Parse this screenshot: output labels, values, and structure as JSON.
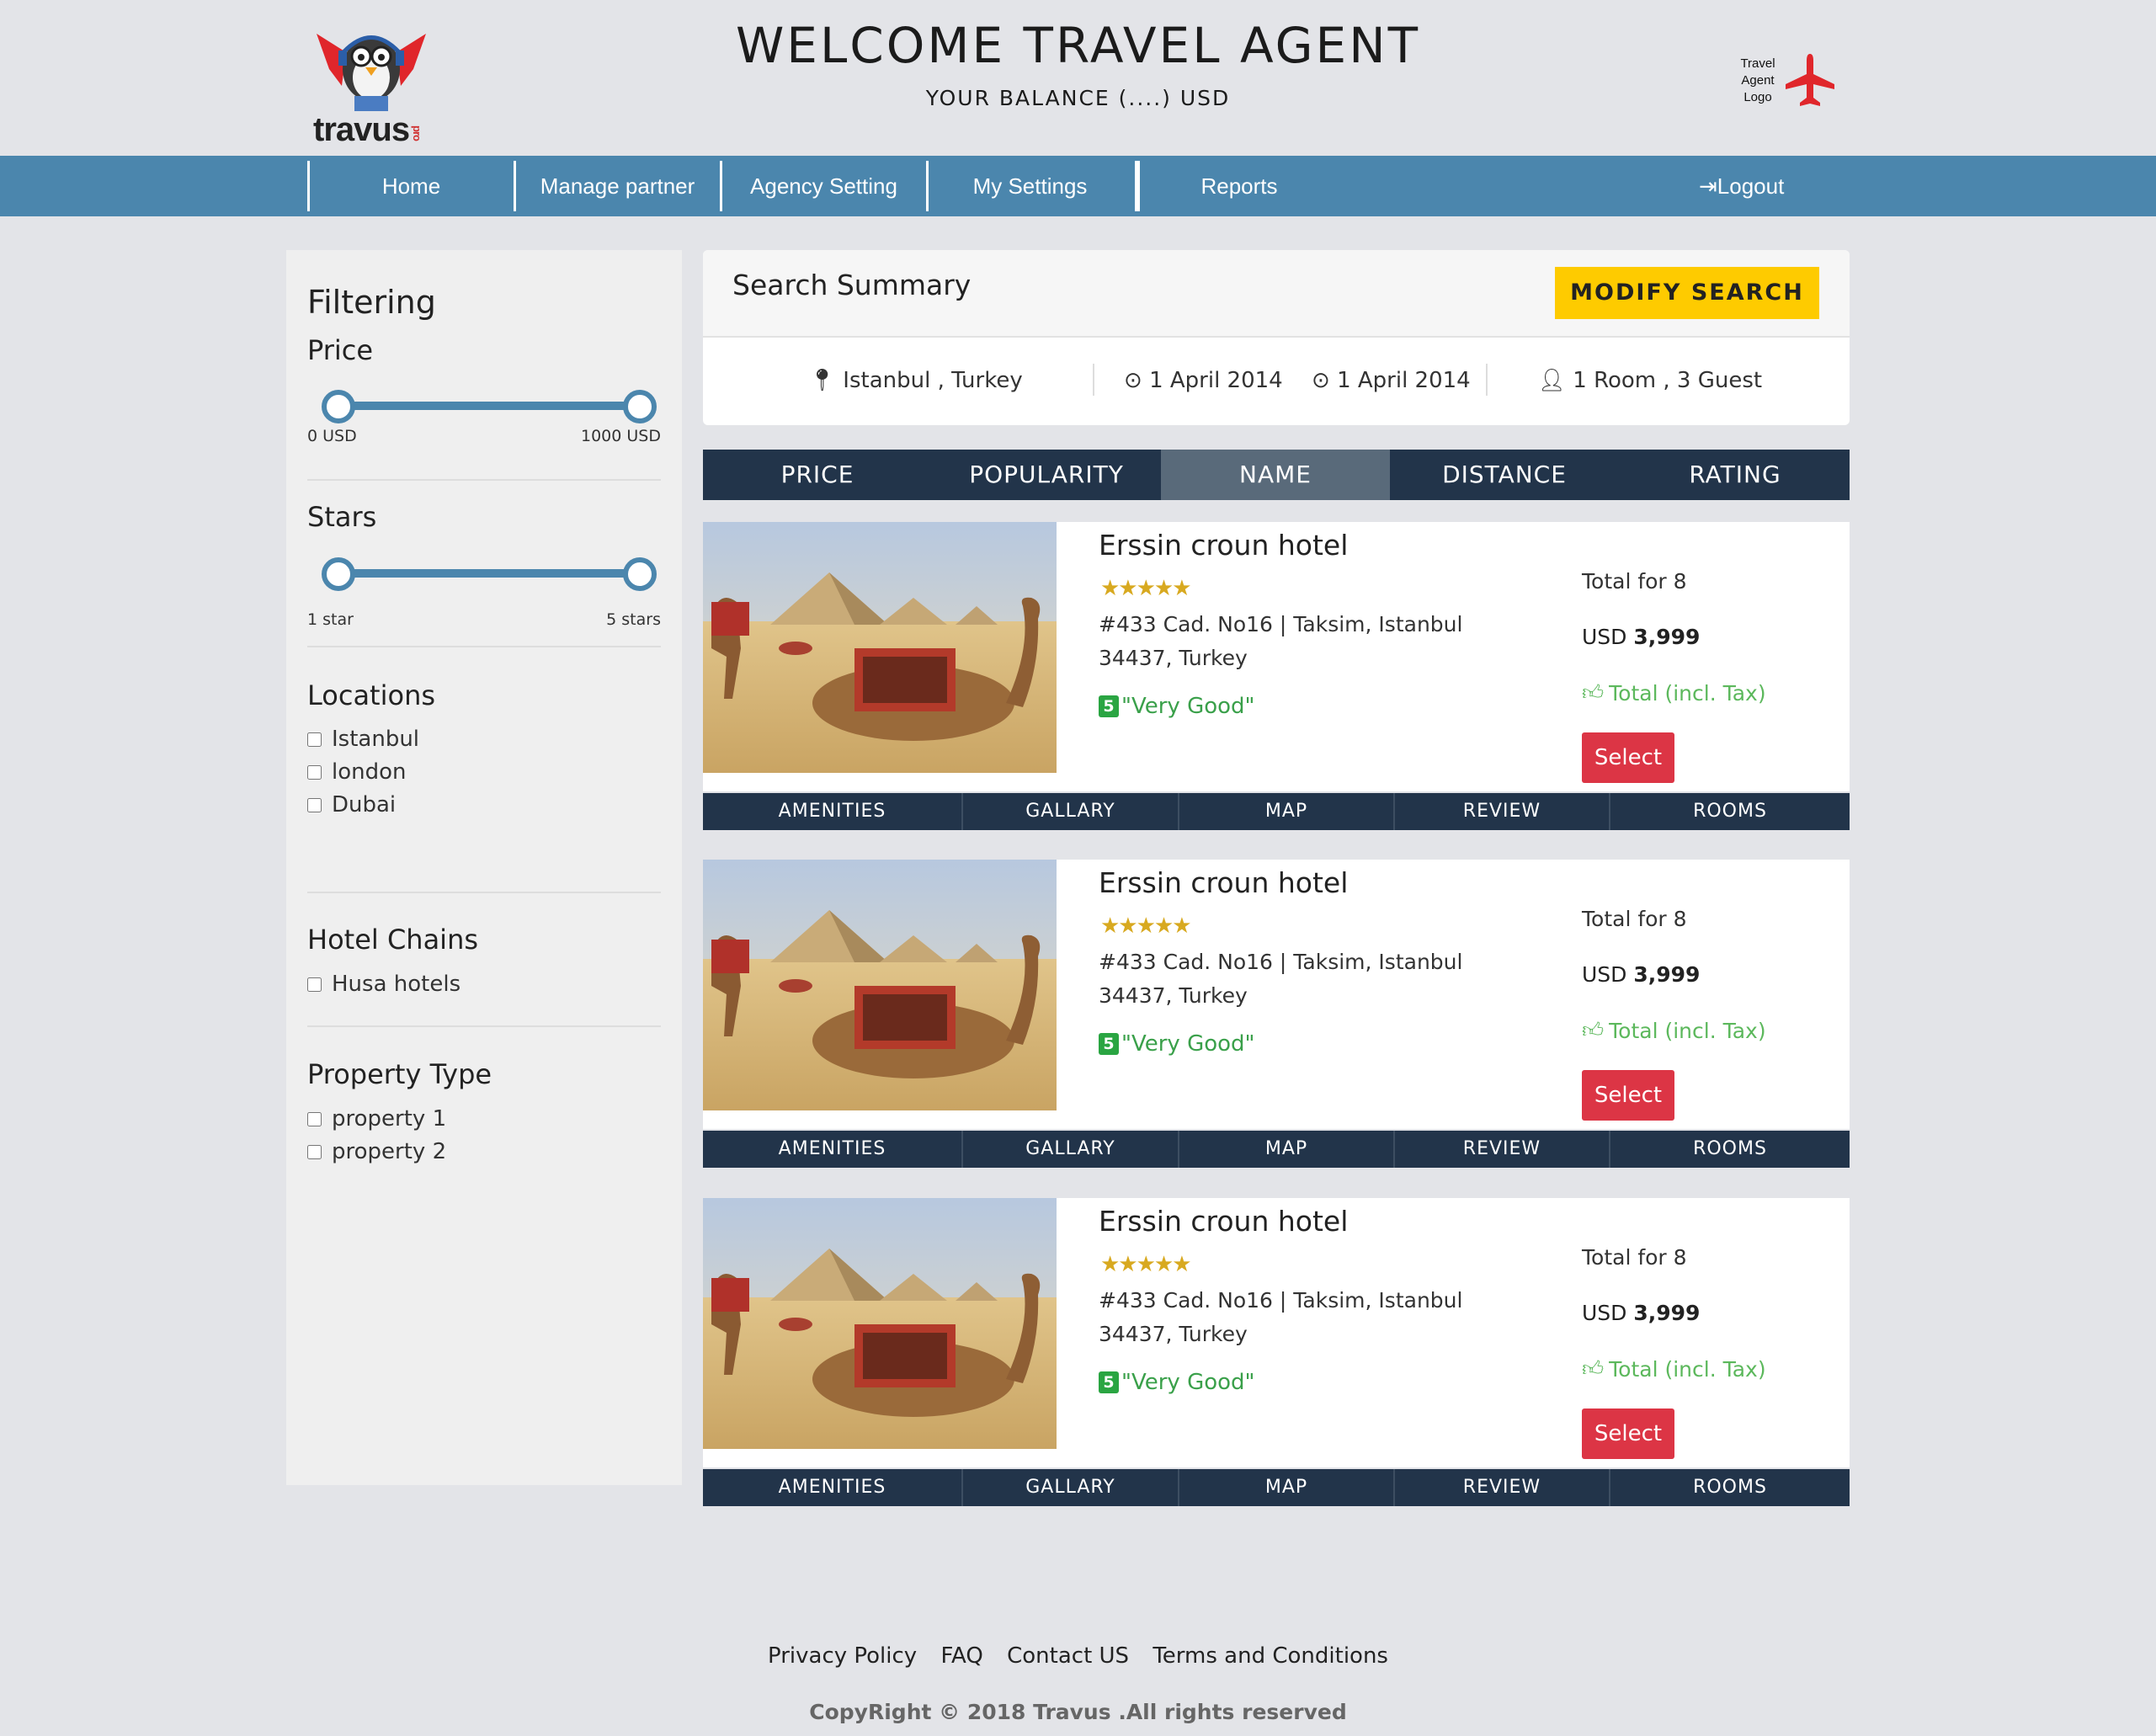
{
  "header": {
    "logo_text": "travus",
    "logo_tag": "pro",
    "welcome": "WELCOME TRAVEL AGENT",
    "balance": "YOUR BALANCE (....) USD",
    "agent_logo_line1": "Travel",
    "agent_logo_line2": "Agent",
    "agent_logo_line3": "Logo"
  },
  "nav": {
    "items": [
      {
        "label": "Home"
      },
      {
        "label": "Manage partner"
      },
      {
        "label": "Agency Setting"
      },
      {
        "label": "My Settings"
      },
      {
        "label": "Reports"
      }
    ],
    "logout": "Logout",
    "accent": "#4b86ad"
  },
  "sidebar": {
    "title": "Filtering",
    "price": {
      "heading": "Price",
      "min_label": "0 USD",
      "max_label": "1000 USD"
    },
    "stars": {
      "heading": "Stars",
      "min_label": "1 star",
      "max_label": "5 stars"
    },
    "locations": {
      "heading": "Locations",
      "options": [
        "Istanbul",
        "london",
        "Dubai"
      ]
    },
    "chains": {
      "heading": "Hotel Chains",
      "options": [
        "Husa hotels"
      ]
    },
    "property": {
      "heading": "Property Type",
      "options": [
        "property 1",
        "property 2"
      ]
    }
  },
  "summary": {
    "title": "Search Summary",
    "modify": "MODIFY SEARCH",
    "location": "Istanbul , Turkey",
    "checkin": "1 April 2014",
    "checkout": "1 April 2014",
    "guests": "1 Room , 3 Guest"
  },
  "sort": {
    "items": [
      "PRICE",
      "POPULARITY",
      "NAME",
      "DISTANCE",
      "RATING"
    ],
    "active": "NAME"
  },
  "hotels": [
    {
      "name": "Erssin croun hotel",
      "stars": "★★★★★",
      "address": "#433 Cad. No16 | Taksim, Istanbul 34437, Turkey",
      "rating_score": "5",
      "rating_text": "\"Very Good\"",
      "total_for": "Total for 8",
      "currency": "USD",
      "price": "3,999",
      "incl": "Total (incl. Tax)",
      "select": "Select"
    },
    {
      "name": "Erssin croun hotel",
      "stars": "★★★★★",
      "address": "#433 Cad. No16 | Taksim, Istanbul 34437, Turkey",
      "rating_score": "5",
      "rating_text": "\"Very Good\"",
      "total_for": "Total for 8",
      "currency": "USD",
      "price": "3,999",
      "incl": "Total (incl. Tax)",
      "select": "Select"
    },
    {
      "name": "Erssin croun hotel",
      "stars": "★★★★★",
      "address": "#433 Cad. No16 | Taksim, Istanbul 34437, Turkey",
      "rating_score": "5",
      "rating_text": "\"Very Good\"",
      "total_for": "Total for 8",
      "currency": "USD",
      "price": "3,999",
      "incl": "Total (incl. Tax)",
      "select": "Select"
    }
  ],
  "card_tabs": [
    "AMENITIES",
    "GALLARY",
    "MAP",
    "REVIEW",
    "ROOMS"
  ],
  "footer": {
    "links": [
      "Privacy Policy",
      "FAQ",
      "Contact US",
      "Terms and Conditions"
    ],
    "copyright": "CopyRight © 2018 Travus .All rights reserved"
  }
}
